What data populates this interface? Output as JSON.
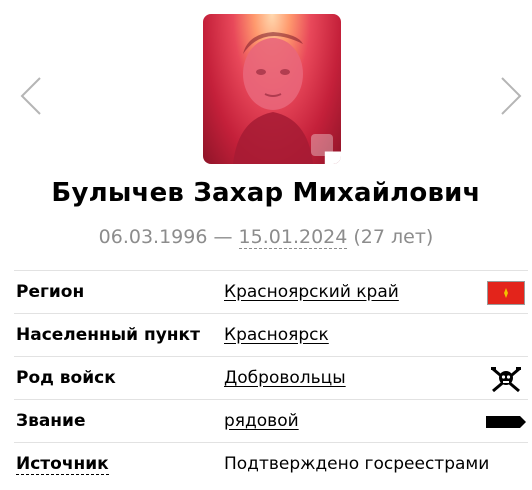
{
  "navigation": {
    "prev_icon": "chevron-left-icon",
    "next_icon": "chevron-right-icon"
  },
  "profile": {
    "name": "Булычев Захар Михайлович",
    "birth_date": "06.03.1996",
    "separator": " — ",
    "death_date": "15.01.2024",
    "age": " (27 лет)",
    "photo_badge_icon": "flag-icon"
  },
  "details": {
    "region": {
      "label": "Регион",
      "value": "Красноярский край",
      "icon": "region-flag-icon"
    },
    "settlement": {
      "label": "Населенный пункт",
      "value": "Красноярск"
    },
    "troops": {
      "label": "Род войск",
      "value": "Добровольцы",
      "icon": "volunteers-emblem-icon"
    },
    "rank": {
      "label": "Звание",
      "value": "рядовой",
      "icon": "rank-shoulder-mark-icon"
    },
    "source": {
      "label": "Источник",
      "value": "Подтверждено госреестрами"
    }
  },
  "colors": {
    "accent_red": "#e3241b",
    "muted_gray": "#8c8c8c",
    "divider": "#e2e2e2"
  }
}
